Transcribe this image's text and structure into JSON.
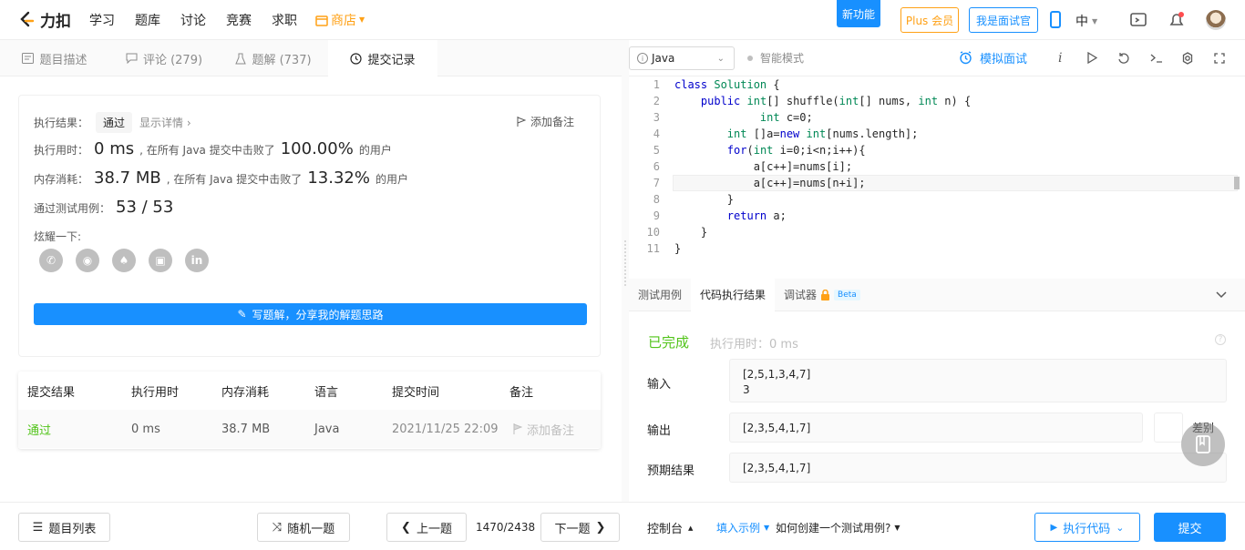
{
  "nav": {
    "brand": "力扣",
    "items": [
      "学习",
      "题库",
      "讨论",
      "竞赛",
      "求职"
    ],
    "shop": "商店",
    "new_feature": "新功能",
    "plus": "Plus 会员",
    "interviewer": "我是面试官",
    "lang": "中"
  },
  "left_tabs": [
    {
      "label": "题目描述"
    },
    {
      "label": "评论 (279)"
    },
    {
      "label": "题解 (737)"
    },
    {
      "label": "提交记录"
    }
  ],
  "result": {
    "label_result": "执行结果：",
    "status": "通过",
    "show_detail": "显示详情 ›",
    "add_note": "添加备注",
    "label_time": "执行用时：",
    "time_value": "0 ms",
    "beat_text": ", 在所有 Java 提交中击败了",
    "time_pct": "100.00%",
    "users": "的用户",
    "label_mem": "内存消耗：",
    "mem_value": "38.7 MB",
    "mem_pct": "13.32%",
    "label_cases": "通过测试用例：",
    "cases": "53 / 53",
    "share_label": "炫耀一下:",
    "write_btn": "写题解，分享我的解题思路"
  },
  "table": {
    "headers": [
      "提交结果",
      "执行用时",
      "内存消耗",
      "语言",
      "提交时间",
      "备注"
    ],
    "row": {
      "result": "通过",
      "time": "0 ms",
      "memory": "38.7 MB",
      "lang": "Java",
      "submitted": "2021/11/25 22:09",
      "note": "添加备注"
    }
  },
  "editor": {
    "language": "Java",
    "smart_mode": "智能模式",
    "mock_interview": "模拟面试",
    "lines": [
      "class Solution {",
      "    public int[] shuffle(int[] nums, int n) {",
      "             int c=0;",
      "        int []a=new int[nums.length];",
      "        for(int i=0;i<n;i++){",
      "            a[c++]=nums[i];",
      "            a[c++]=nums[n+i];",
      "        }",
      "        return a;",
      "    }",
      "}"
    ]
  },
  "console": {
    "tabs": [
      "测试用例",
      "代码执行结果",
      "调试器"
    ],
    "beta": "Beta",
    "status": "已完成",
    "exec_time": "执行用时：0 ms",
    "input_label": "输入",
    "input_line1": "[2,5,1,3,4,7]",
    "input_line2": "3",
    "output_label": "输出",
    "output_value": "[2,3,5,4,1,7]",
    "diff": "差别",
    "expected_label": "预期结果",
    "expected_value": "[2,3,5,4,1,7]"
  },
  "bottom": {
    "problem_list": "题目列表",
    "random": "随机一题",
    "prev": "上一题",
    "page": "1470/2438",
    "next": "下一题",
    "console": "控制台",
    "fill_example": "填入示例",
    "how_to": "如何创建一个测试用例?",
    "run": "执行代码",
    "submit": "提交"
  },
  "colors": {
    "accent": "#1890ff",
    "brand": "#ffa116",
    "pass": "#52c41a"
  }
}
